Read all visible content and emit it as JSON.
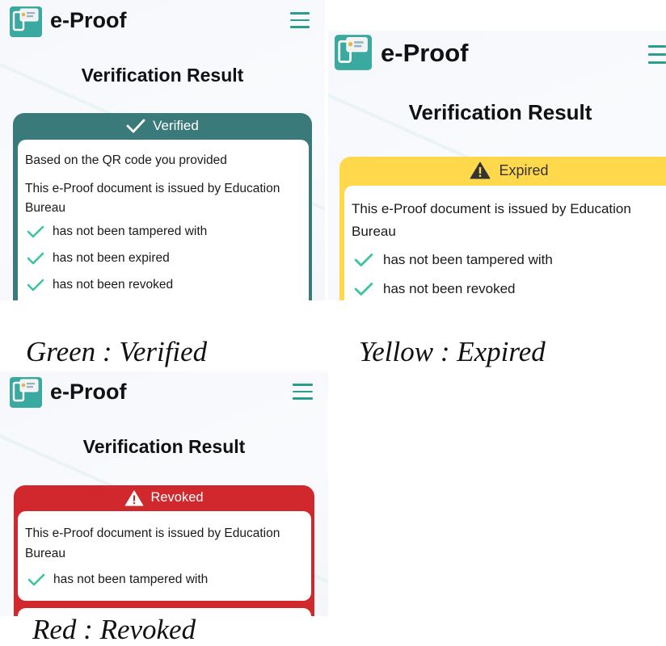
{
  "colors": {
    "green": "#3a7a7a",
    "yellow": "#ffd84c",
    "red": "#d0282c",
    "check": "#3cc3a0",
    "menu": "#2a9d8f"
  },
  "panels": [
    {
      "app_title": "e-Proof",
      "page_title": "Verification Result",
      "status": "Verified",
      "status_icon": "checkmark-icon",
      "lines": [
        "Based on the QR code you provided",
        "This e-Proof document is issued by Education Bureau"
      ],
      "checks": [
        "has not been tampered with",
        "has not been expired",
        "has not been revoked"
      ],
      "caption": "Green : Verified"
    },
    {
      "app_title": "e-Proof",
      "page_title": "Verification Result",
      "status": "Expired",
      "status_icon": "warning-icon",
      "lines": [
        "This e-Proof document is issued by Education Bureau"
      ],
      "checks": [
        "has not been tampered with",
        "has not been revoked"
      ],
      "caption": "Yellow : Expired"
    },
    {
      "app_title": "e-Proof",
      "page_title": "Verification Result",
      "status": "Revoked",
      "status_icon": "warning-icon",
      "lines": [
        "This e-Proof document is issued by Education Bureau"
      ],
      "checks": [
        "has not been tampered with"
      ],
      "caption": "Red : Revoked"
    }
  ]
}
